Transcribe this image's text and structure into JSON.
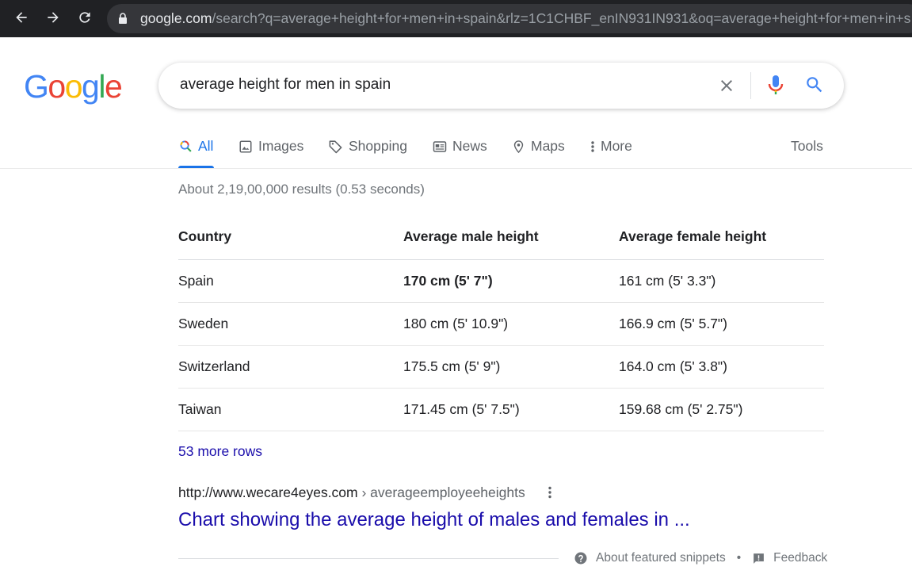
{
  "browser": {
    "url_host": "google.com",
    "url_rest": "/search?q=average+height+for+men+in+spain&rlz=1C1CHBF_enIN931IN931&oq=average+height+for+men+in+s"
  },
  "logo": {
    "letters": [
      "G",
      "o",
      "o",
      "g",
      "l",
      "e"
    ],
    "colors": [
      "#4285f4",
      "#ea4335",
      "#fbbc05",
      "#4285f4",
      "#34a853",
      "#ea4335"
    ]
  },
  "search": {
    "query": "average height for men in spain"
  },
  "tabs": [
    {
      "label": "All",
      "icon": "search-icon"
    },
    {
      "label": "Images",
      "icon": "image-icon"
    },
    {
      "label": "Shopping",
      "icon": "tag-icon"
    },
    {
      "label": "News",
      "icon": "news-icon"
    },
    {
      "label": "Maps",
      "icon": "map-pin-icon"
    },
    {
      "label": "More",
      "icon": "more-vert-icon"
    }
  ],
  "tools_label": "Tools",
  "stats": "About 2,19,00,000 results (0.53 seconds)",
  "table": {
    "headers": [
      "Country",
      "Average male height",
      "Average female height"
    ],
    "rows": [
      [
        "Spain",
        "170 cm (5' 7\")",
        "161 cm (5' 3.3\")"
      ],
      [
        "Sweden",
        "180 cm (5' 10.9\")",
        "166.9 cm (5' 5.7\")"
      ],
      [
        "Switzerland",
        "175.5 cm (5' 9\")",
        "164.0 cm (5' 3.8\")"
      ],
      [
        "Taiwan",
        "171.45 cm (5' 7.5\")",
        "159.68 cm (5' 2.75\")"
      ]
    ]
  },
  "more_rows": "53 more rows",
  "result": {
    "cite_host": "http://www.wecare4eyes.com",
    "cite_path": " › averageemployeeheights",
    "title": "Chart showing the average height of males and females in ..."
  },
  "footer": {
    "about": "About featured snippets",
    "dot": "•",
    "feedback": "Feedback"
  },
  "colors": {
    "link": "#1a0dab",
    "accent": "#1a73e8",
    "chrome_bg": "#202124"
  }
}
